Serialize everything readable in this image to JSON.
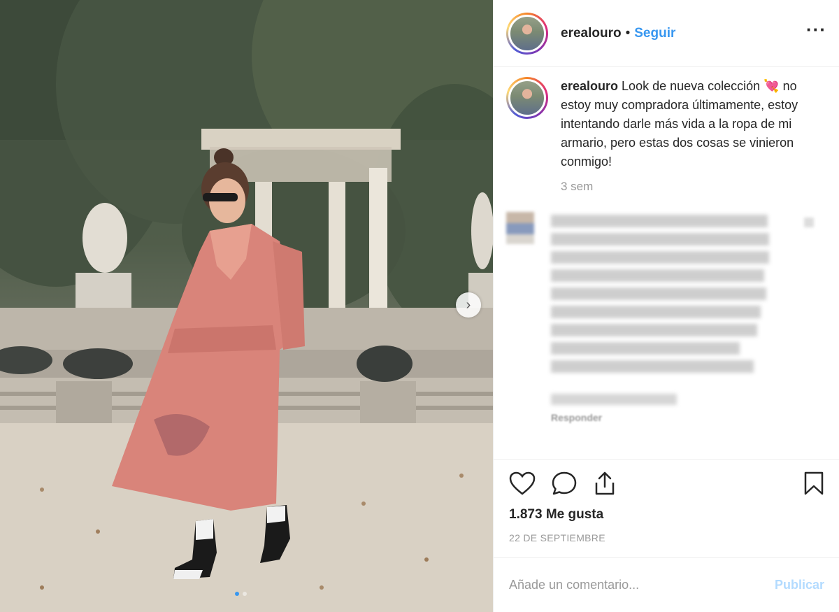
{
  "post": {
    "username": "erealouro",
    "follow_label": "Seguir",
    "separator": "•",
    "more_label": "···",
    "caption_text": "Look de nueva colección",
    "caption_emoji": "💘",
    "caption_rest": " no estoy muy compradora últimamente, estoy intentando darle más vida a la ropa de mi armario, pero estas dos cosas se vinieron conmigo!",
    "caption_time": "3 sem",
    "reply_label": "Responder",
    "likes": "1.873 Me gusta",
    "date": "22 DE SEPTIEMBRE",
    "comment_placeholder": "Añade un comentario...",
    "publish_label": "Publicar",
    "carousel_count": 2,
    "carousel_active": 1
  },
  "colors": {
    "link_blue": "#3897f0",
    "publish_disabled": "#b3dbff",
    "muted_text": "#999999",
    "dress": "#d9847a"
  },
  "icons": {
    "like": "heart-icon",
    "comment": "comment-bubble-icon",
    "share": "share-icon",
    "save": "bookmark-icon",
    "next": "chevron-right-icon"
  }
}
